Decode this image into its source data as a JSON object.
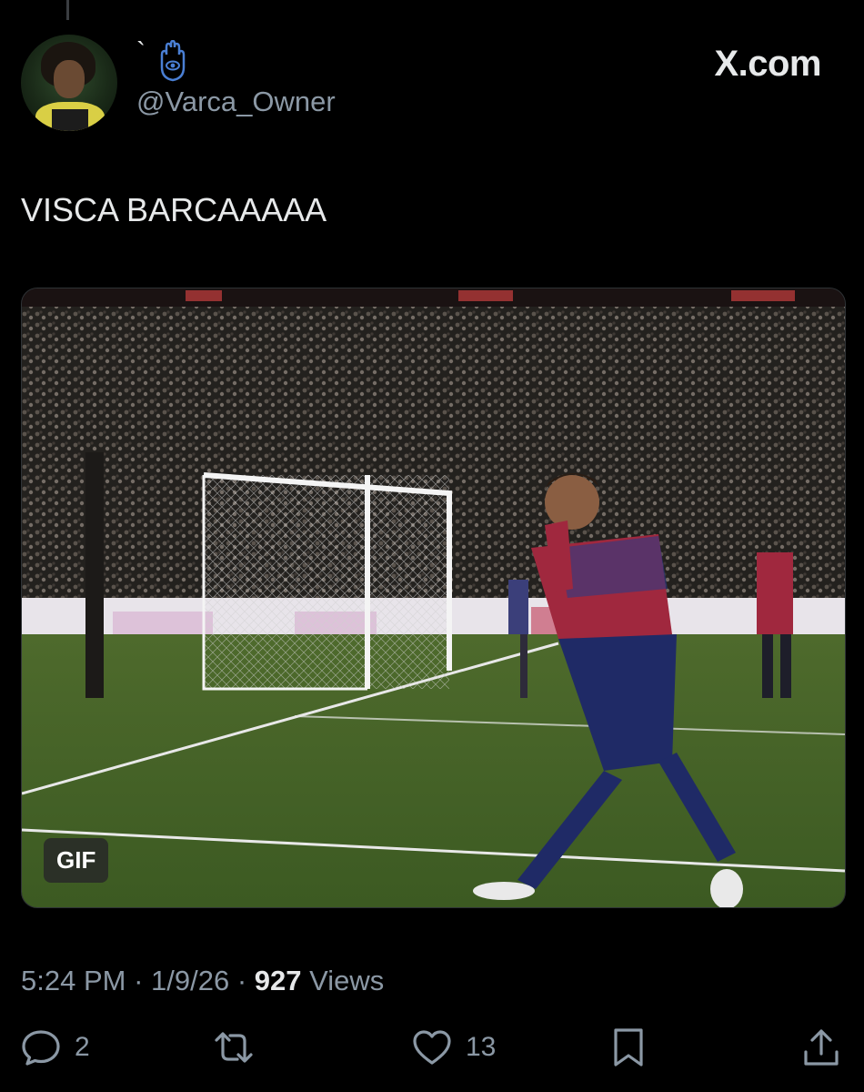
{
  "user": {
    "display_name": "`",
    "handle": "@Varca_Owner",
    "display_name_icon": "hamsa-icon",
    "avatar_icon": "avatar-photo"
  },
  "brand": {
    "label": "X.com"
  },
  "tweet": {
    "text": "VISCA BARCAAAAA",
    "media_badge": "GIF"
  },
  "meta": {
    "time": "5:24 PM",
    "sep1": " · ",
    "date": "1/9/26",
    "sep2": " · ",
    "views_count": "927",
    "views_label": " Views"
  },
  "actions": {
    "reply": {
      "icon": "reply-icon",
      "count": "2"
    },
    "retweet": {
      "icon": "retweet-icon",
      "count": ""
    },
    "like": {
      "icon": "heart-icon",
      "count": "13"
    },
    "bookmark": {
      "icon": "bookmark-icon"
    },
    "share": {
      "icon": "share-icon"
    }
  },
  "colors": {
    "background": "#000000",
    "text": "#e7e9ea",
    "secondary_text": "#8b98a5",
    "hamsa_blue": "#4a7fd4"
  }
}
